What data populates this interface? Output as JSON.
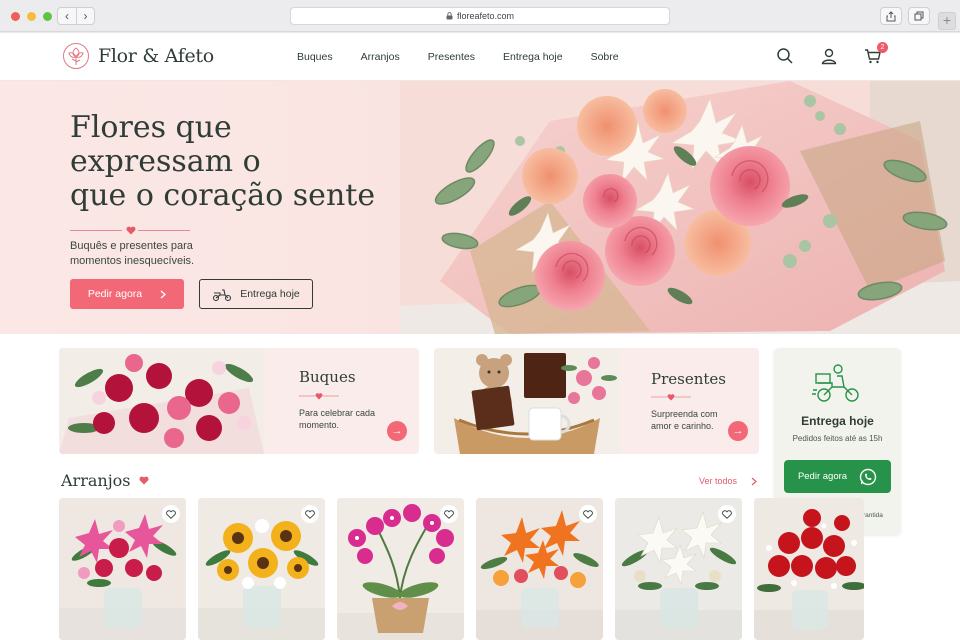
{
  "browser": {
    "url": "floreafeto.com"
  },
  "header": {
    "brand": "Flor & Afeto",
    "nav": [
      "Buques",
      "Arranjos",
      "Presentes",
      "Entrega hoje",
      "Sobre"
    ],
    "cart_count": "2",
    "icons": [
      "search-icon",
      "user-icon",
      "cart-icon"
    ]
  },
  "hero": {
    "title_lines": [
      "Flores que",
      "expressam o",
      "que o coração sente"
    ],
    "subtitle": "Buquês e presentes para momentos inesquecíveis.",
    "primary_cta": "Pedir agora",
    "secondary_cta": "Entrega hoje"
  },
  "categories": [
    {
      "title": "Buques",
      "desc": "Para celebrar cada momento."
    },
    {
      "title": "Presentes",
      "desc": "Surpreenda com amor e carinho."
    }
  ],
  "delivery": {
    "title": "Entrega hoje",
    "subtitle": "Pedidos feitos até as 15h",
    "cta": "Pedir agora",
    "footer": "Entrega segura e garantida"
  },
  "arranjos": {
    "title": "Arranjos",
    "see_all": "Ver todos",
    "products": [
      {
        "name": "pink-lilies-arrangement"
      },
      {
        "name": "sunflower-arrangement"
      },
      {
        "name": "orchid-basket"
      },
      {
        "name": "orange-lily-arrangement"
      },
      {
        "name": "white-lily-arrangement"
      },
      {
        "name": "red-rose-arrangement"
      }
    ]
  },
  "colors": {
    "accent": "#f26877",
    "green": "#27934a",
    "text": "#2f3d36",
    "hero_bg": "#fbe8e6"
  }
}
